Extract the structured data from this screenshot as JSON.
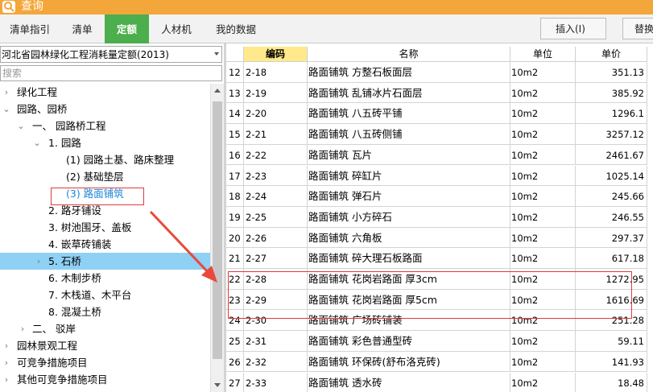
{
  "window": {
    "title": "查询"
  },
  "tabs": [
    {
      "label": "清单指引"
    },
    {
      "label": "清单"
    },
    {
      "label": "定额"
    },
    {
      "label": "人材机"
    },
    {
      "label": "我的数据"
    }
  ],
  "toolbar": {
    "insert_label": "插入(I)",
    "replace_label": "替换("
  },
  "library": {
    "selected": "河北省园林绿化工程消耗量定额(2013)"
  },
  "search": {
    "placeholder": "搜索"
  },
  "tree": [
    {
      "label": "绿化工程",
      "toggle": "›"
    },
    {
      "label": "园路、园桥",
      "toggle": "⌄"
    },
    {
      "label": "一、 园路桥工程",
      "toggle": "⌄"
    },
    {
      "label": "1. 园路",
      "toggle": "⌄"
    },
    {
      "label": "(1) 园路土基、路床整理",
      "toggle": ""
    },
    {
      "label": "(2) 基础垫层",
      "toggle": ""
    },
    {
      "label": "(3) 路面铺筑",
      "toggle": ""
    },
    {
      "label": "2. 路牙铺设",
      "toggle": ""
    },
    {
      "label": "3. 树池围牙、盖板",
      "toggle": ""
    },
    {
      "label": "4. 嵌草砖铺装",
      "toggle": ""
    },
    {
      "label": "5. 石桥",
      "toggle": "›"
    },
    {
      "label": "6. 木制步桥",
      "toggle": ""
    },
    {
      "label": "7. 木栈道、木平台",
      "toggle": ""
    },
    {
      "label": "8. 混凝土桥",
      "toggle": ""
    },
    {
      "label": "二、 驳岸",
      "toggle": "›"
    },
    {
      "label": "园林景观工程",
      "toggle": "›"
    },
    {
      "label": "可竞争措施项目",
      "toggle": "›"
    },
    {
      "label": "其他可竞争措施项目",
      "toggle": "›"
    }
  ],
  "grid": {
    "headers": {
      "code": "编码",
      "name": "名称",
      "unit": "单位",
      "price": "单价"
    },
    "rows": [
      {
        "n": "12",
        "code": "2-18",
        "name": "路面铺筑 方整石板面层",
        "unit": "10m2",
        "price": "351.13"
      },
      {
        "n": "13",
        "code": "2-19",
        "name": "路面铺筑 乱铺冰片石面层",
        "unit": "10m2",
        "price": "385.92"
      },
      {
        "n": "14",
        "code": "2-20",
        "name": "路面铺筑 八五砖平铺",
        "unit": "10m2",
        "price": "1296.1"
      },
      {
        "n": "15",
        "code": "2-21",
        "name": "路面铺筑 八五砖侧铺",
        "unit": "10m2",
        "price": "3257.12"
      },
      {
        "n": "16",
        "code": "2-22",
        "name": "路面铺筑 瓦片",
        "unit": "10m2",
        "price": "2461.67"
      },
      {
        "n": "17",
        "code": "2-23",
        "name": "路面铺筑 碎缸片",
        "unit": "10m2",
        "price": "1025.14"
      },
      {
        "n": "18",
        "code": "2-24",
        "name": "路面铺筑 弹石片",
        "unit": "10m2",
        "price": "245.66"
      },
      {
        "n": "19",
        "code": "2-25",
        "name": "路面铺筑 小方碎石",
        "unit": "10m2",
        "price": "246.55"
      },
      {
        "n": "20",
        "code": "2-26",
        "name": "路面铺筑 六角板",
        "unit": "10m2",
        "price": "297.37"
      },
      {
        "n": "21",
        "code": "2-27",
        "name": "路面铺筑 碎大理石板路面",
        "unit": "10m2",
        "price": "617.18"
      },
      {
        "n": "22",
        "code": "2-28",
        "name": "路面铺筑 花岗岩路面 厚3cm",
        "unit": "10m2",
        "price": "1272.95"
      },
      {
        "n": "23",
        "code": "2-29",
        "name": "路面铺筑 花岗岩路面 厚5cm",
        "unit": "10m2",
        "price": "1616.69"
      },
      {
        "n": "24",
        "code": "2-30",
        "name": "路面铺筑 广场砖铺装",
        "unit": "10m2",
        "price": "251.28"
      },
      {
        "n": "25",
        "code": "2-31",
        "name": "路面铺筑 彩色普通型砖",
        "unit": "10m2",
        "price": "59.11"
      },
      {
        "n": "26",
        "code": "2-32",
        "name": "路面铺筑 环保砖(舒布洛克砖)",
        "unit": "10m2",
        "price": "141.93"
      },
      {
        "n": "27",
        "code": "2-33",
        "name": "路面铺筑 透水砖",
        "unit": "10m2",
        "price": "18.48"
      }
    ]
  },
  "colors": {
    "title_bar": "#f3a63a",
    "active_tab": "#4cae4c",
    "selected_node": "#8fd0f5",
    "code_header": "#ffe98a",
    "annotation": "#e03a3a"
  },
  "icons": {
    "app": "magnifier-app-icon",
    "combo_arrow": "chevron-down-icon"
  }
}
